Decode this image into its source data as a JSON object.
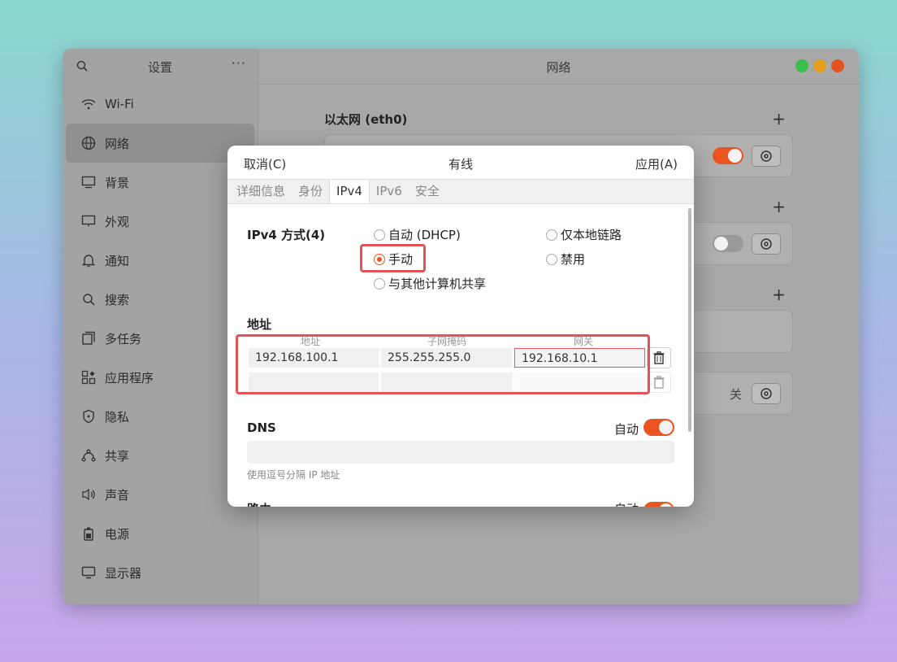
{
  "sidebar": {
    "title": "设置",
    "menu": "···",
    "items": [
      {
        "label": "Wi-Fi",
        "icon": "wifi-icon"
      },
      {
        "label": "网络",
        "icon": "network-icon"
      },
      {
        "label": "背景",
        "icon": "background-icon"
      },
      {
        "label": "外观",
        "icon": "appearance-icon"
      },
      {
        "label": "通知",
        "icon": "bell-icon"
      },
      {
        "label": "搜索",
        "icon": "search-icon"
      },
      {
        "label": "多任务",
        "icon": "multitask-icon"
      },
      {
        "label": "应用程序",
        "icon": "apps-icon"
      },
      {
        "label": "隐私",
        "icon": "shield-icon"
      },
      {
        "label": "共享",
        "icon": "share-icon"
      },
      {
        "label": "声音",
        "icon": "speaker-icon"
      },
      {
        "label": "电源",
        "icon": "power-icon"
      },
      {
        "label": "显示器",
        "icon": "display-icon"
      }
    ]
  },
  "main": {
    "title": "网络",
    "ethernet_title": "以太网 (eth0)",
    "off_label": "关",
    "plus": "+"
  },
  "dialog": {
    "cancel": "取消(C)",
    "title": "有线",
    "apply": "应用(A)",
    "tabs": [
      "详细信息",
      "身份",
      "IPv4",
      "IPv6",
      "安全"
    ],
    "ipv4_method_label": "IPv4 方式(4)",
    "methods": {
      "auto": "自动 (DHCP)",
      "local": "仅本地链路",
      "manual": "手动",
      "disabled": "禁用",
      "shared": "与其他计算机共享"
    },
    "address_section": "地址",
    "columns": [
      "地址",
      "子网掩码",
      "网关"
    ],
    "rows": [
      {
        "address": "192.168.100.1",
        "netmask": "255.255.255.0",
        "gateway": "192.168.10.1"
      }
    ],
    "dns_label": "DNS",
    "dns_auto_label": "自动",
    "dns_hint": "使用逗号分隔 IP 地址",
    "routes_label": "路由",
    "routes_auto_label": "自动"
  },
  "colors": {
    "accent": "#e95420",
    "highlight": "#e0545a"
  }
}
